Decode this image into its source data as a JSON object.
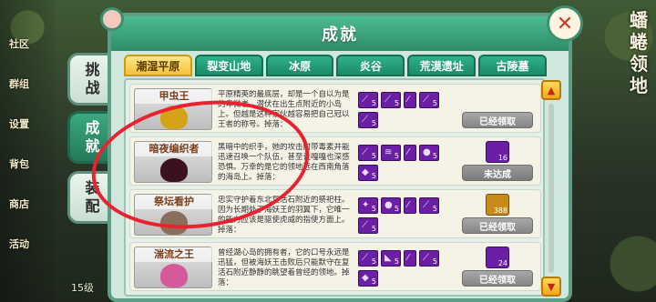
{
  "window": {
    "title": "成就",
    "close_icon": "close-x-icon"
  },
  "side_tabs": [
    {
      "label_1": "挑",
      "label_2": "战",
      "active": false
    },
    {
      "label_1": "成",
      "label_2": "就",
      "active": true
    },
    {
      "label_1": "装",
      "label_2": "配",
      "active": false
    }
  ],
  "region_tabs": [
    {
      "label": "潮湿平原",
      "active": true
    },
    {
      "label": "裂变山地",
      "active": false
    },
    {
      "label": "冰原",
      "active": false
    },
    {
      "label": "炎谷",
      "active": false
    },
    {
      "label": "荒漠遗址",
      "active": false
    },
    {
      "label": "古陵墓",
      "active": false
    }
  ],
  "achievements": [
    {
      "name": "甲虫王",
      "desc": "平原精英的最底层，却是一个自以为是的卑微者，潜伏在出生点附近的小岛上。但越是这种家伙越容易把自己冠以王者的称号。掉落：",
      "rewards": [
        "5",
        "5",
        "",
        "5",
        "5"
      ],
      "claim_count": "",
      "claim_label": "已经领取"
    },
    {
      "name": "暗夜编织者",
      "desc": "黑暗中的织手，她的攻击附带毒素并能迅速召唤一个队伍，甚至让嘎嘎也深感恐惧。万幸的是它的领地远在西南角落的海岛上。掉落：",
      "rewards": [
        "5",
        "5",
        "",
        "5",
        "5"
      ],
      "claim_count": "16",
      "claim_label": "未达成"
    },
    {
      "name": "祭坛看护",
      "desc": "忠实守护着东北复活石附近的祭祀柱。因为长期处于海妖王的羽翼下，它唯一的能力应该是驱使虎威的指使方面上。掉落：",
      "rewards": [
        "5",
        "5",
        "",
        "5",
        "5"
      ],
      "claim_count": "388",
      "claim_label": "已经领取"
    },
    {
      "name": "湍流之王",
      "desc": "曾经湖心岛的拥有者，它的口号永远是迅猛，但被海妖王击败后只能默守在复活石附近静静的眺望着曾经的领地。掉落：",
      "rewards": [
        "5",
        "5",
        "",
        "5",
        "5"
      ],
      "claim_count": "24",
      "claim_label": "已经领取"
    }
  ],
  "background": {
    "left_labels": [
      "社区",
      "群组",
      "设置",
      "背包",
      "商店",
      "活动"
    ],
    "right_text": "蟠蜷领地",
    "bottom_count": "15级"
  },
  "annotation": {
    "color": "#e8232f",
    "shape": "circle-around-row-2-3"
  },
  "colors": {
    "panel_bg": "#cfe7dd",
    "title_bar": "#2e8d68",
    "active_region_tab": "#f4c23a",
    "reward_purple": "#6a1fa5",
    "claim_button_gray": "#858585"
  }
}
